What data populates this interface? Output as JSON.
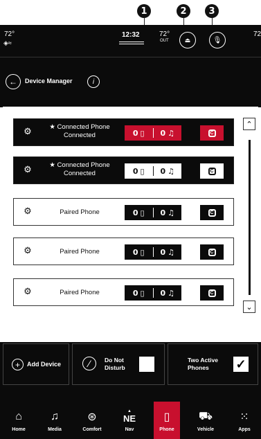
{
  "callouts": [
    "1",
    "2",
    "3"
  ],
  "status": {
    "temp_left": "72°",
    "time": "12:32",
    "temp_out": "72°",
    "out_label": "OUT",
    "temp_right": "72"
  },
  "header": {
    "title": "Device Manager"
  },
  "devices": [
    {
      "name": "Connected Phone",
      "status": "Connected",
      "favorite": true,
      "style": "dark",
      "active": true,
      "calls": "0",
      "media": "0"
    },
    {
      "name": "Connected Phone",
      "status": "Connected",
      "favorite": true,
      "style": "dark",
      "active": false,
      "calls": "0",
      "media": "0"
    },
    {
      "name": "Paired Phone",
      "status": "",
      "favorite": false,
      "style": "light",
      "active": false,
      "calls": "0",
      "media": "0"
    },
    {
      "name": "Paired Phone",
      "status": "",
      "favorite": false,
      "style": "light",
      "active": false,
      "calls": "0",
      "media": "0"
    },
    {
      "name": "Paired Phone",
      "status": "",
      "favorite": false,
      "style": "light",
      "active": false,
      "calls": "0",
      "media": "0"
    }
  ],
  "actions": {
    "add_device": "Add Device",
    "dnd_line1": "Do Not",
    "dnd_line2": "Disturb",
    "dnd_checked": false,
    "two_line1": "Two Active",
    "two_line2": "Phones",
    "two_checked": true
  },
  "nav": [
    {
      "label": "Home",
      "icon": "home-icon"
    },
    {
      "label": "Media",
      "icon": "music-note-icon"
    },
    {
      "label": "Comfort",
      "icon": "seat-icon"
    },
    {
      "label": "Nav",
      "icon": "compass-icon",
      "badge": "NE"
    },
    {
      "label": "Phone",
      "icon": "phone-icon",
      "active": true
    },
    {
      "label": "Vehicle",
      "icon": "car-icon"
    },
    {
      "label": "Apps",
      "icon": "apps-grid-icon"
    }
  ],
  "colors": {
    "accent": "#c8102e",
    "bar": "#0b0b0b"
  }
}
